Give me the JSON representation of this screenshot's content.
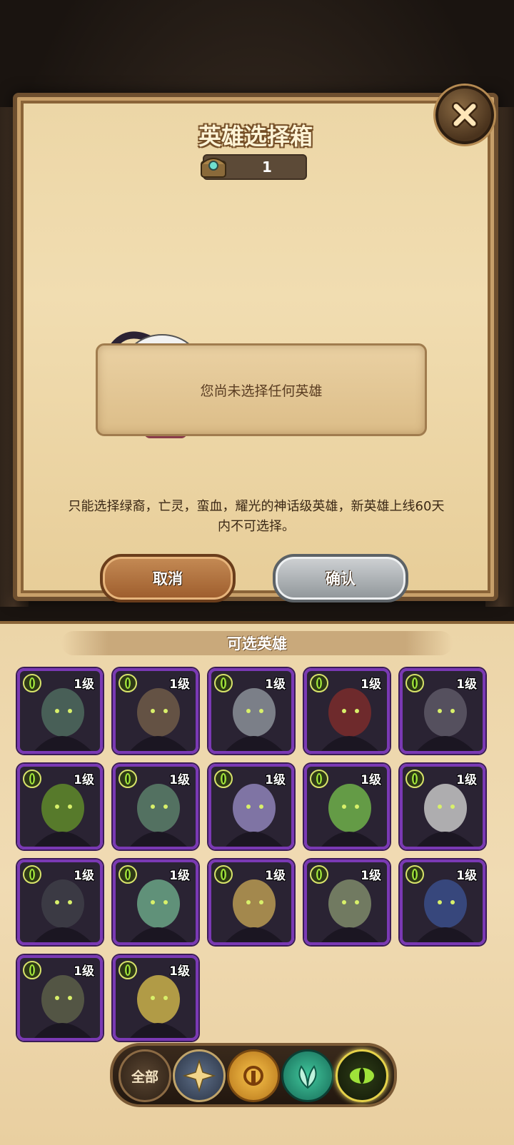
{
  "dialog": {
    "title": "英雄选择箱",
    "count": "1",
    "message": "您尚未选择任何英雄",
    "notice": "只能选择绿裔，亡灵，蛮血，耀光的神话级英雄，新英雄上线60天内不可选择。",
    "cancel_label": "取消",
    "confirm_label": "确认"
  },
  "selectable_section": {
    "title": "可选英雄",
    "heroes": [
      {
        "level": "1级",
        "faction_icon": "eye-icon",
        "accent": "#4d6a5e"
      },
      {
        "level": "1级",
        "faction_icon": "eye-icon",
        "accent": "#6e5a48"
      },
      {
        "level": "1级",
        "faction_icon": "eye-icon",
        "accent": "#8a8f98"
      },
      {
        "level": "1级",
        "faction_icon": "eye-icon",
        "accent": "#7a2c2c"
      },
      {
        "level": "1级",
        "faction_icon": "eye-icon",
        "accent": "#5d5866"
      },
      {
        "level": "1级",
        "faction_icon": "eye-icon",
        "accent": "#5f8a2a"
      },
      {
        "level": "1级",
        "faction_icon": "eye-icon",
        "accent": "#5a7f6a"
      },
      {
        "level": "1级",
        "faction_icon": "eye-icon",
        "accent": "#8e82b8"
      },
      {
        "level": "1级",
        "faction_icon": "eye-icon",
        "accent": "#6fb04a"
      },
      {
        "level": "1级",
        "faction_icon": "eye-icon",
        "accent": "#c6c6c6"
      },
      {
        "level": "1级",
        "faction_icon": "eye-icon",
        "accent": "#3e3e48"
      },
      {
        "level": "1级",
        "faction_icon": "eye-icon",
        "accent": "#6aa586"
      },
      {
        "level": "1级",
        "faction_icon": "eye-icon",
        "accent": "#b89a52"
      },
      {
        "level": "1级",
        "faction_icon": "eye-icon",
        "accent": "#7e8a6a"
      },
      {
        "level": "1级",
        "faction_icon": "eye-icon",
        "accent": "#3a4e8a"
      },
      {
        "level": "1级",
        "faction_icon": "eye-icon",
        "accent": "#5a5e48"
      },
      {
        "level": "1级",
        "faction_icon": "eye-icon",
        "accent": "#c9b04a"
      }
    ]
  },
  "filters": [
    {
      "label": "全部",
      "icon": "all-filter"
    },
    {
      "label": "",
      "icon": "star-icon"
    },
    {
      "label": "",
      "icon": "sun-icon"
    },
    {
      "label": "",
      "icon": "leaf-icon"
    },
    {
      "label": "",
      "icon": "eye-icon"
    }
  ],
  "colors": {
    "card_border": "#7a39b4",
    "parchment": "#ecd6a6",
    "text_dark": "#3b2815"
  }
}
